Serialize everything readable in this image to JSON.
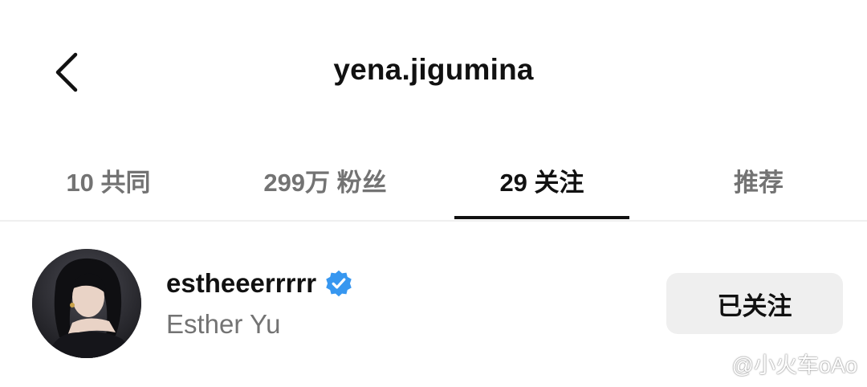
{
  "header": {
    "title": "yena.jigumina",
    "back_icon": "chevron-left-icon"
  },
  "tabs": [
    {
      "label": "10 共同",
      "active": false
    },
    {
      "label": "299万 粉丝",
      "active": false
    },
    {
      "label": "29 关注",
      "active": true
    },
    {
      "label": "推荐",
      "active": false
    }
  ],
  "following_list": [
    {
      "username": "estheeerrrrr",
      "full_name": "Esther Yu",
      "verified": true,
      "button_label": "已关注"
    }
  ],
  "watermark": {
    "text": "@小火车oAo",
    "icon": "weibo-icon"
  },
  "colors": {
    "primary_text": "#111111",
    "secondary_text": "#737373",
    "verified_blue": "#3797f0",
    "button_bg": "#efefef",
    "divider": "#efefef"
  }
}
